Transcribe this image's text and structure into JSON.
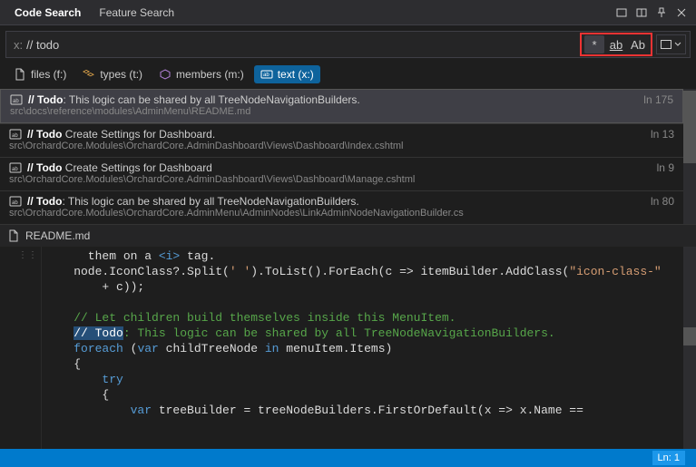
{
  "titlebar": {
    "tab_code": "Code Search",
    "tab_feature": "Feature Search"
  },
  "search": {
    "prefix": "x:",
    "query": "// todo",
    "opt_regex": "*",
    "opt_word": "ab",
    "opt_case": "Ab"
  },
  "filters": {
    "files": "files (f:)",
    "types": "types (t:)",
    "members": "members (m:)",
    "text": "text (x:)"
  },
  "results": [
    {
      "title_bold": "// Todo",
      "title_rest": ": This logic can be shared by all TreeNodeNavigationBuilders.",
      "path": "src\\docs\\reference\\modules\\AdminMenu\\README.md",
      "line": "ln 175",
      "selected": true
    },
    {
      "title_bold": "// Todo",
      "title_rest": " Create Settings for Dashboard.",
      "path": "src\\OrchardCore.Modules\\OrchardCore.AdminDashboard\\Views\\Dashboard\\Index.cshtml",
      "line": "ln 13",
      "selected": false
    },
    {
      "title_bold": "// Todo",
      "title_rest": " Create Settings for Dashboard",
      "path": "src\\OrchardCore.Modules\\OrchardCore.AdminDashboard\\Views\\Dashboard\\Manage.cshtml",
      "line": "ln 9",
      "selected": false
    },
    {
      "title_bold": "// Todo",
      "title_rest": ": This logic can be shared by all TreeNodeNavigationBuilders.",
      "path": "src\\OrchardCore.Modules\\OrchardCore.AdminMenu\\AdminNodes\\LinkAdminNodeNavigationBuilder.cs",
      "line": "ln 80",
      "selected": false
    }
  ],
  "preview": {
    "file": "README.md"
  },
  "code": {
    "l1a": "      them on a ",
    "l1b": "<i>",
    "l1c": " tag.",
    "l2a": "    node.IconClass?.Split(",
    "l2s": "' '",
    "l2b": ").ToList().ForEach(c => itemBuilder.AddClass(",
    "l2s2": "\"icon-class-\"",
    "l3": "        + c));",
    "l4": "",
    "l5": "    // Let children build themselves inside this MenuItem.",
    "l6a": "    ",
    "l6hl": "// Todo",
    "l6b": ": This logic can be shared by all TreeNodeNavigationBuilders.",
    "l7a": "    ",
    "l7kw": "foreach",
    "l7b": " (",
    "l7kw2": "var",
    "l7c": " childTreeNode ",
    "l7kw3": "in",
    "l7d": " menuItem.Items)",
    "l8": "    {",
    "l9a": "        ",
    "l9kw": "try",
    "l10": "        {",
    "l11a": "            ",
    "l11kw": "var",
    "l11b": " treeBuilder = treeNodeBuilders.FirstOrDefault(x => x.Name =="
  },
  "status": {
    "pos": "Ln: 1"
  }
}
